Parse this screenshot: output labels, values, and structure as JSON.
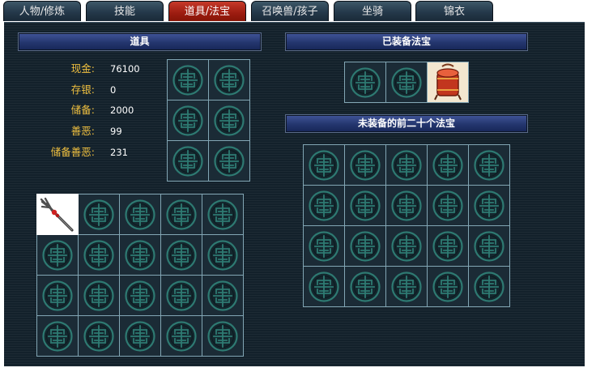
{
  "tabs": [
    {
      "label": "人物/修炼"
    },
    {
      "label": "技能"
    },
    {
      "label": "道具/法宝",
      "active": true
    },
    {
      "label": "召唤兽/孩子"
    },
    {
      "label": "坐骑"
    },
    {
      "label": "锦衣"
    }
  ],
  "items_panel": {
    "title": "道具",
    "stats": [
      {
        "label": "现金:",
        "value": "76100"
      },
      {
        "label": "存银:",
        "value": "0"
      },
      {
        "label": "储备:",
        "value": "2000"
      },
      {
        "label": "善恶:",
        "value": "99"
      },
      {
        "label": "储备善恶:",
        "value": "231"
      }
    ],
    "side_slots": {
      "columns": 2,
      "rows": 3,
      "items": []
    },
    "inventory": {
      "columns": 5,
      "rows": 4,
      "items": [
        {
          "index": 0,
          "icon": "trident-weapon-icon"
        }
      ]
    }
  },
  "equipped_treasure": {
    "title": "已装备法宝",
    "slots": {
      "columns": 3,
      "rows": 1,
      "items": [
        {
          "index": 2,
          "icon": "drum-treasure-icon"
        }
      ]
    }
  },
  "unequipped_treasure": {
    "title": "未装备的前二十个法宝",
    "slots": {
      "columns": 5,
      "rows": 4,
      "items": []
    }
  },
  "colors": {
    "active_tab": "#9c1c10",
    "inactive_tab": "#24384a",
    "panel_background": "#13212b",
    "header_bar": "#24366e",
    "stat_label": "#f0c040",
    "grid_line": "#82a6b4",
    "empty_slot_emblem": "#2e7a72"
  }
}
